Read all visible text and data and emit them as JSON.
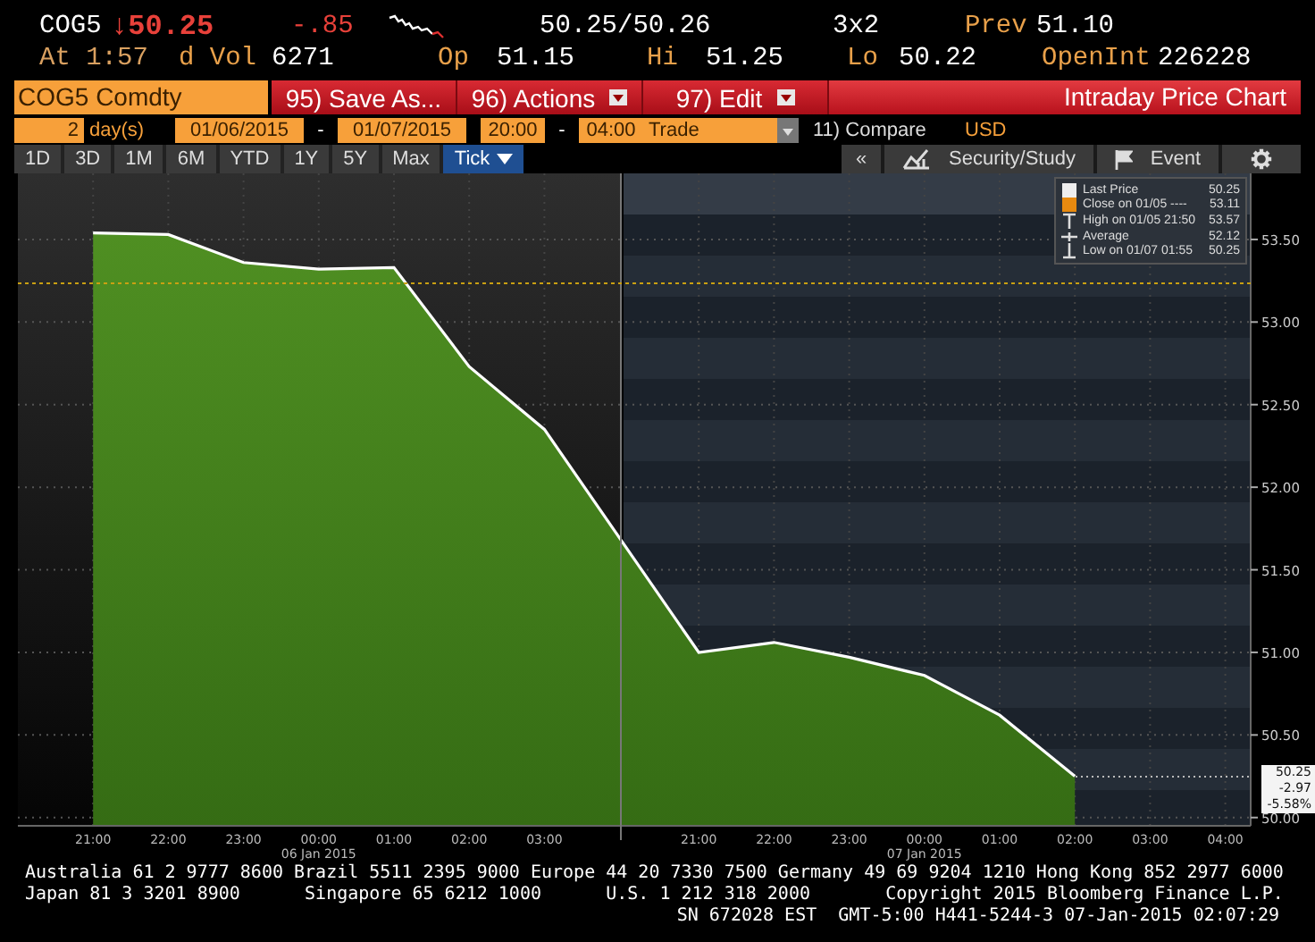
{
  "quote": {
    "ticker": "COG5",
    "last": "↓50.25",
    "change": "-.85",
    "bid_ask": "50.25/50.26",
    "size": "3x2",
    "prev": {
      "label": "Prev",
      "value": "51.10"
    },
    "stats": [
      {
        "label": "At",
        "value": "1:57"
      },
      {
        "label": "d Vol",
        "value": "6271"
      },
      {
        "label": "Op",
        "value": "51.15"
      },
      {
        "label": "Hi",
        "value": "51.25"
      },
      {
        "label": "Lo",
        "value": "50.22"
      },
      {
        "label": "OpenInt",
        "value": "226228"
      }
    ]
  },
  "toolbar": {
    "security": "COG5 Comdty",
    "buttons": [
      {
        "label": "95) Save As...",
        "dropdown": false
      },
      {
        "label": "96) Actions",
        "dropdown": true
      },
      {
        "label": "97) Edit",
        "dropdown": true
      }
    ],
    "title": "Intraday Price Chart"
  },
  "range": {
    "count": "2",
    "unit": "day(s)",
    "from_date": "01/06/2015",
    "date_separator": "-",
    "to_date": "01/07/2015",
    "from_time": "20:00",
    "time_separator": "-",
    "to_time": "04:00",
    "market": "Trade",
    "compare": "11) Compare",
    "currency": "USD"
  },
  "periods": [
    {
      "label": "1D",
      "selected": false
    },
    {
      "label": "3D",
      "selected": false
    },
    {
      "label": "1M",
      "selected": false
    },
    {
      "label": "6M",
      "selected": false
    },
    {
      "label": "YTD",
      "selected": false
    },
    {
      "label": "1Y",
      "selected": false
    },
    {
      "label": "5Y",
      "selected": false
    },
    {
      "label": "Max",
      "selected": false
    },
    {
      "label": "Tick",
      "selected": true,
      "dropdown": true
    }
  ],
  "chart_tools": [
    {
      "kind": "collapse",
      "label": "«"
    },
    {
      "kind": "study",
      "label": "Security/Study"
    },
    {
      "kind": "event",
      "label": "Event"
    },
    {
      "kind": "settings"
    }
  ],
  "chart": {
    "legend": [
      {
        "kind": "last",
        "label": "Last Price",
        "value": "50.25"
      },
      {
        "kind": "close",
        "label": "Close on 01/05 ----",
        "value": "53.11"
      },
      {
        "kind": "high",
        "label": "High on 01/05 21:50",
        "value": "53.57"
      },
      {
        "kind": "average",
        "label": "Average",
        "value": "52.12"
      },
      {
        "kind": "low",
        "label": "Low on 01/07 01:55",
        "value": "50.25"
      }
    ],
    "last_tag": [
      "50.25",
      "-2.97",
      "-5.58%"
    ],
    "day_labels": [
      "06 Jan 2015",
      "07 Jan 2015"
    ],
    "chart_data": {
      "type": "area",
      "categories": [
        "21:00",
        "22:00",
        "23:00",
        "00:00",
        "01:00",
        "02:00",
        "03:00",
        "21:00",
        "22:00",
        "23:00",
        "00:00",
        "01:00",
        "02:00",
        "03:00",
        "04:00"
      ],
      "series": [
        {
          "color": "#ffffff",
          "values": [
            53.54,
            53.53,
            53.36,
            53.32,
            53.33,
            52.73,
            52.35,
            51.0,
            51.06,
            50.97,
            50.86,
            50.62,
            50.25,
            null,
            null
          ]
        }
      ],
      "ylim": [
        49.95,
        53.9
      ],
      "grid": true,
      "yticks": [
        {
          "value": 50,
          "label": "50.00"
        },
        {
          "value": 50.5,
          "label": "50.50"
        },
        {
          "value": 51,
          "label": "51.00"
        },
        {
          "value": 51.5,
          "label": "51.50"
        },
        {
          "value": 52,
          "label": "52.00"
        },
        {
          "value": 52.5,
          "label": "52.50"
        },
        {
          "value": 53,
          "label": "53.00"
        },
        {
          "value": 53.5,
          "label": "53.50"
        }
      ]
    }
  },
  "footer": {
    "lines": [
      "Australia 61 2 9777 8600 Brazil 5511 2395 9000 Europe 44 20 7330 7500 Germany 49 69 9204 1210 Hong Kong 852 2977 6000",
      "Japan 81 3 3201 8900      Singapore 65 6212 1000      U.S. 1 212 318 2000       Copyright 2015 Bloomberg Finance L.P.",
      "SN 672028 EST  GMT-5:00 H441-5244-3 07-Jan-2015 02:07:29"
    ]
  }
}
